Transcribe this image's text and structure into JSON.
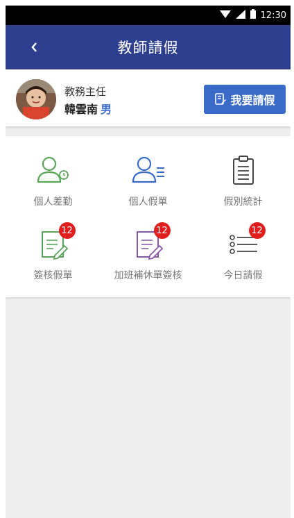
{
  "status_bar": {
    "time": "12:30"
  },
  "app_bar": {
    "title": "教師請假"
  },
  "profile": {
    "role": "教務主任",
    "name": "韓雲南",
    "gender": "男",
    "leave_button": "我要請假"
  },
  "menu": {
    "personal_attendance": "個人差勤",
    "personal_leave": "個人假單",
    "leave_stats": "假別統計",
    "approve_leave": "簽核假單",
    "approve_overtime": "加班補休單簽核",
    "today_leave": "今日請假",
    "approve_leave_badge": "12",
    "approve_overtime_badge": "12",
    "today_leave_badge": "12"
  },
  "colors": {
    "app_bar": "#2f3f8f",
    "button": "#3a6bc9",
    "badge": "#e01e1e",
    "green_icon": "#5aa55a",
    "blue_icon": "#3a6bc9",
    "purple_icon": "#8a5aa8"
  }
}
